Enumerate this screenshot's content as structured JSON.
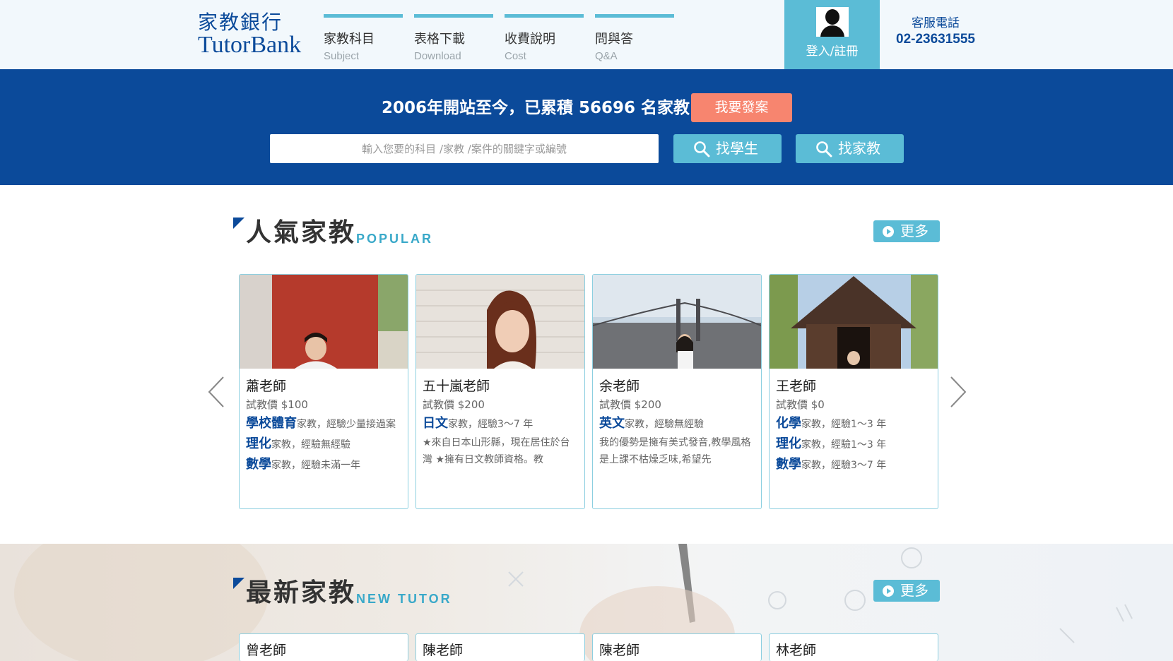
{
  "header": {
    "logo_cn": "家教銀行",
    "logo_en": "TutorBank",
    "nav": [
      {
        "cn": "家教科目",
        "en": "Subject"
      },
      {
        "cn": "表格下載",
        "en": "Download"
      },
      {
        "cn": "收費說明",
        "en": "Cost"
      },
      {
        "cn": "問與答",
        "en": "Q&A"
      }
    ],
    "login_label": "登入/註冊",
    "hotline_label": "客服電話",
    "hotline_number": "02-23631555"
  },
  "banner": {
    "text": "2006年開站至今，已累積 56696 名家教",
    "post_button": "我要發案",
    "search_placeholder": "輸入您要的科目 /家教 /案件的關鍵字或編號",
    "find_students": "找學生",
    "find_tutors": "找家教"
  },
  "popular": {
    "title_cn": "人氣家教",
    "title_en": "POPULAR",
    "more_label": "更多",
    "cards": [
      {
        "name": "蕭老師",
        "price": "試教價 $100",
        "subjects": [
          {
            "subject": "學校體育",
            "detail": "家教，經驗少量接過案"
          },
          {
            "subject": "理化",
            "detail": "家教，經驗無經驗"
          },
          {
            "subject": "數學",
            "detail": "家教，經驗未滿一年"
          }
        ],
        "description": ""
      },
      {
        "name": "五十嵐老師",
        "price": "試教價 $200",
        "subjects": [
          {
            "subject": "日文",
            "detail": "家教，經驗3～7 年"
          }
        ],
        "description": "★來自日本山形縣，現在居住於台灣 ★擁有日文教師資格。教"
      },
      {
        "name": "余老師",
        "price": "試教價 $200",
        "subjects": [
          {
            "subject": "英文",
            "detail": "家教，經驗無經驗"
          }
        ],
        "description": "我的優勢是擁有美式發音,教學風格是上課不枯燥乏味,希望先"
      },
      {
        "name": "王老師",
        "price": "試教價 $0",
        "subjects": [
          {
            "subject": "化學",
            "detail": "家教，經驗1～3 年"
          },
          {
            "subject": "理化",
            "detail": "家教，經驗1～3 年"
          },
          {
            "subject": "數學",
            "detail": "家教，經驗3～7 年"
          }
        ],
        "description": ""
      }
    ]
  },
  "new_tutors": {
    "title_cn": "最新家教",
    "title_en": "NEW TUTOR",
    "more_label": "更多",
    "names": [
      "曾老師",
      "陳老師",
      "陳老師",
      "林老師"
    ]
  },
  "colors": {
    "navy": "#0b4a9a",
    "accent": "#5bbcd6",
    "post_button": "#f7856f"
  }
}
